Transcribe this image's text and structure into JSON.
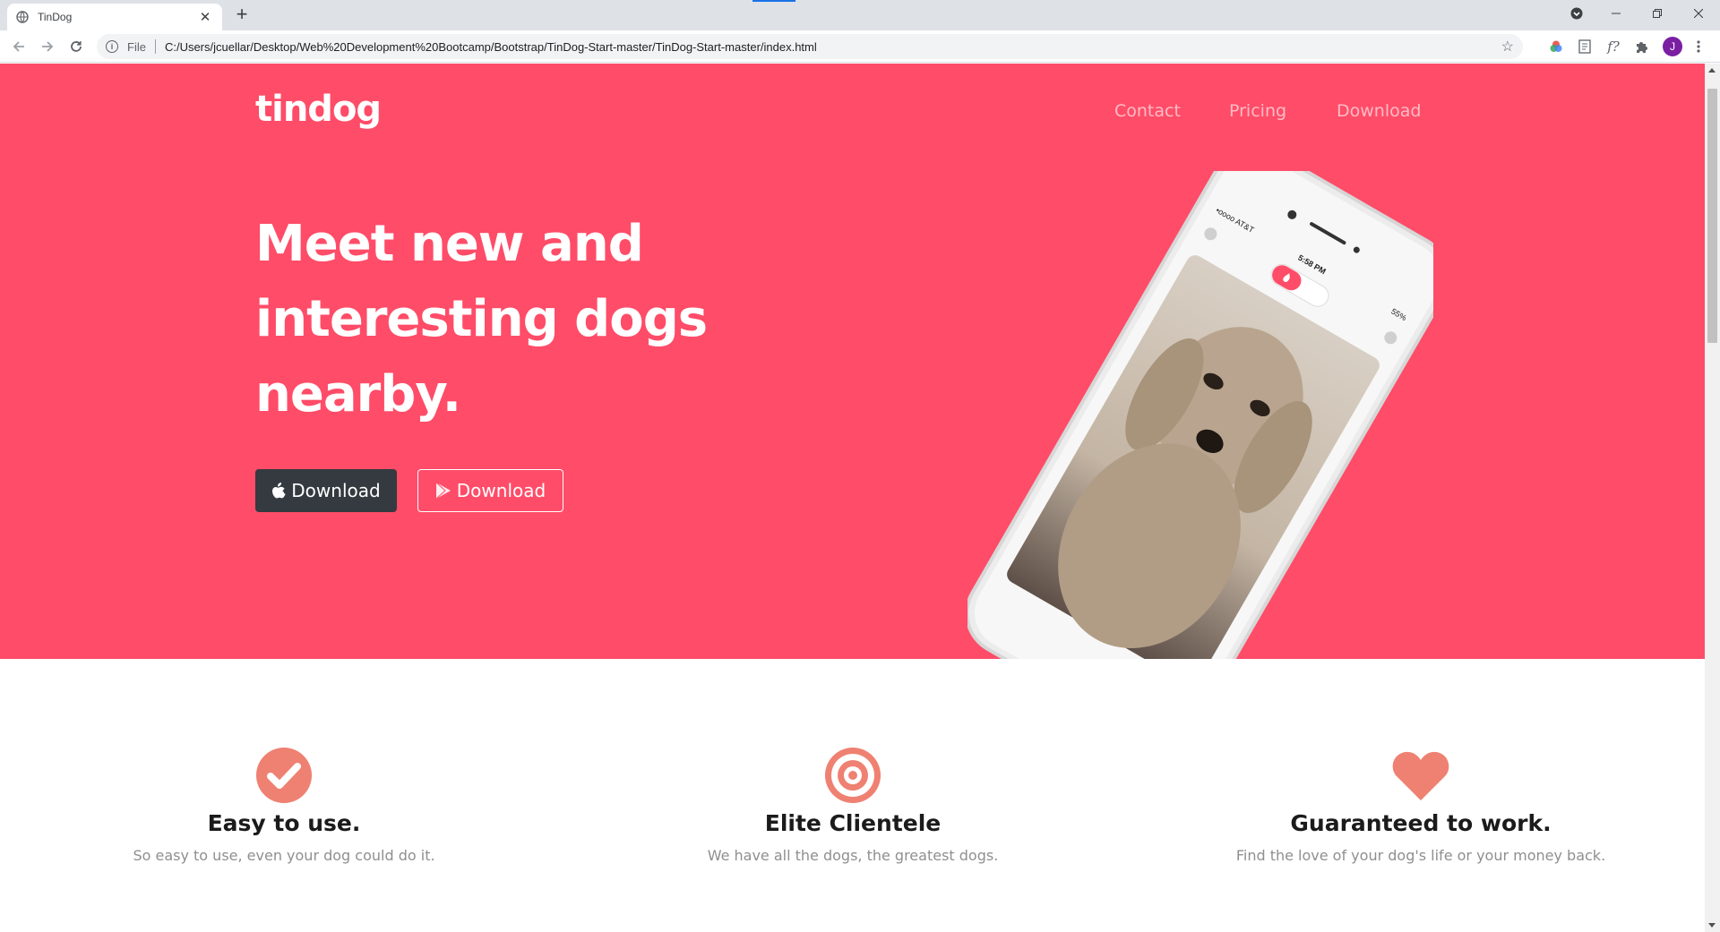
{
  "browser": {
    "tab_title": "TinDog",
    "new_tab_label": "+",
    "scheme_label": "File",
    "url": "C:/Users/jcuellar/Desktop/Web%20Development%20Bootcamp/Bootstrap/TinDog-Start-master/TinDog-Start-master/index.html",
    "profile_initial": "J",
    "font_ext_label": "f?"
  },
  "nav": {
    "brand": "tindog",
    "links": [
      "Contact",
      "Pricing",
      "Download"
    ]
  },
  "hero": {
    "headline_lines": [
      "Meet new and",
      "interesting dogs",
      "nearby."
    ],
    "buttons": [
      {
        "label": "Download",
        "icon": "apple-icon",
        "style": "dark"
      },
      {
        "label": "Download",
        "icon": "play-icon",
        "style": "outline"
      }
    ],
    "phone": {
      "carrier": "•oooo AT&T",
      "time": "5:58 PM",
      "battery": "55%"
    },
    "background_color": "#ff4c68"
  },
  "features": [
    {
      "icon": "check-circle-icon",
      "title": "Easy to use.",
      "text": "So easy to use, even your dog could do it."
    },
    {
      "icon": "bullseye-icon",
      "title": "Elite Clientele",
      "text": "We have all the dogs, the greatest dogs."
    },
    {
      "icon": "heart-icon",
      "title": "Guaranteed to work.",
      "text": "Find the love of your dog's life or your money back."
    }
  ],
  "colors": {
    "accent": "#ff4c68",
    "icon": "#ef8172",
    "dark_button": "#343a40"
  }
}
